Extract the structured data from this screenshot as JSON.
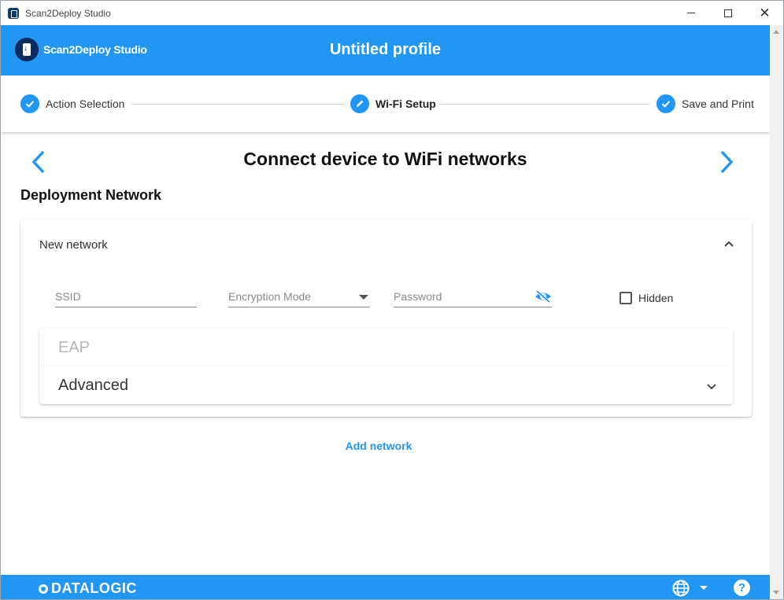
{
  "window": {
    "title": "Scan2Deploy Studio"
  },
  "header": {
    "brand": "Scan2Deploy Studio",
    "title": "Untitled profile"
  },
  "stepper": {
    "steps": [
      {
        "label": "Action Selection",
        "icon": "check-icon",
        "state": "done"
      },
      {
        "label": "Wi-Fi Setup",
        "icon": "pencil-icon",
        "state": "active"
      },
      {
        "label": "Save and Print",
        "icon": "check-icon",
        "state": "done"
      }
    ]
  },
  "page": {
    "heading": "Connect device to WiFi networks",
    "section_title": "Deployment Network",
    "network": {
      "title": "New network",
      "ssid_placeholder": "SSID",
      "encryption_label": "Encryption Mode",
      "password_placeholder": "Password",
      "hidden_label": "Hidden",
      "hidden_checked": false,
      "eap_label": "EAP",
      "advanced_label": "Advanced"
    },
    "add_network": "Add network"
  },
  "footer": {
    "logo": "DATALOGIC",
    "help": "?"
  },
  "colors": {
    "accent": "#2196f3",
    "brand_dark": "#0d2b5e"
  }
}
